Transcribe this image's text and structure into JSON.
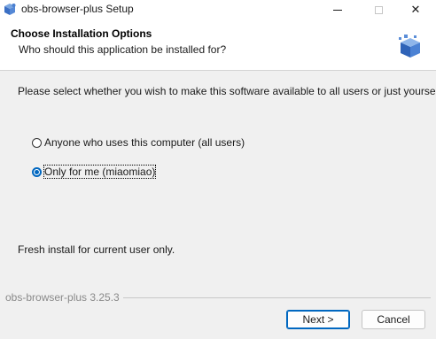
{
  "window": {
    "title": "obs-browser-plus Setup",
    "icon": "installer-icon",
    "controls": {
      "minimize": "minimize-icon",
      "maximize": "maximize-icon",
      "close": "close-icon"
    },
    "close_glyph": "✕"
  },
  "header": {
    "title": "Choose Installation Options",
    "subtitle": "Who should this application be installed for?",
    "icon": "package-icon"
  },
  "body": {
    "prompt": "Please select whether you wish to make this software available to all users or just yourself",
    "options": [
      {
        "label": "Anyone who uses this computer (all users)",
        "selected": false
      },
      {
        "label": "Only for me (miaomiao)",
        "selected": true
      }
    ],
    "status": "Fresh install for current user only."
  },
  "footer": {
    "brand": "obs-browser-plus 3.25.3",
    "next_label": "Next >",
    "cancel_label": "Cancel"
  },
  "colors": {
    "accent": "#0067c0",
    "background": "#f0f0f0",
    "header_bg": "#ffffff"
  }
}
